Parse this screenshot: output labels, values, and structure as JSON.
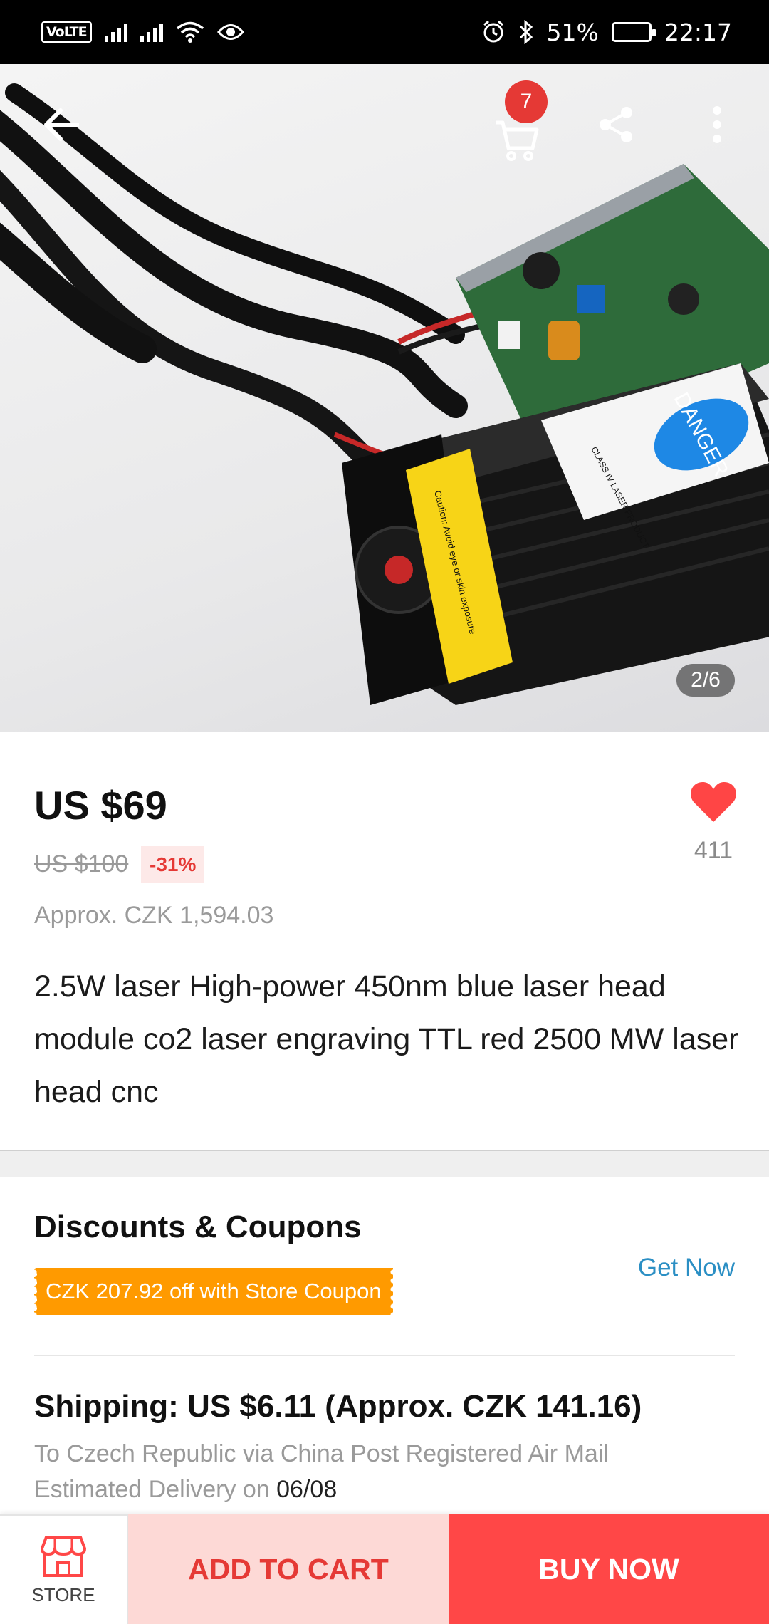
{
  "status_bar": {
    "network_badge": "VoLTE",
    "battery": "51%",
    "battery_level": 0.51,
    "time": "22:17",
    "icons": [
      "signal-icon",
      "signal-icon",
      "wifi-icon",
      "eye-icon",
      "alarm-icon",
      "bluetooth-icon",
      "battery-icon"
    ]
  },
  "header": {
    "cart_count": "7",
    "icons": [
      "back-arrow-icon",
      "cart-icon",
      "share-icon",
      "more-vertical-icon"
    ]
  },
  "gallery": {
    "pager": "2/6",
    "label_text": {
      "danger": "DANGER",
      "caution": "Caution: Avoid eye or skin exposure",
      "class": "CLASS IV LASER PRODUCT"
    }
  },
  "product": {
    "price": "US $69",
    "original_price": "US $100",
    "discount": "-31%",
    "approx_price": "Approx. CZK 1,594.03",
    "wishlist_count": "411",
    "title": "2.5W laser High-power 450nm blue laser head module co2 laser engraving TTL  red 2500 MW laser head cnc"
  },
  "coupons": {
    "heading": "Discounts & Coupons",
    "coupon_text": "CZK 207.92 off with Store Coupon",
    "action": "Get Now"
  },
  "shipping": {
    "heading": "Shipping: US $6.11 (Approx. CZK 141.16)",
    "route": "To Czech Republic via China Post Registered Air Mail",
    "delivery_prefix": "Estimated Delivery on ",
    "delivery_date": "06/08"
  },
  "bottom_bar": {
    "store_label": "STORE",
    "add_to_cart": "ADD TO CART",
    "buy_now": "BUY NOW"
  },
  "colors": {
    "accent_red": "#ff4747",
    "coupon_orange": "#ff9a00",
    "link_blue": "#2b8fc4",
    "heart": "#ff4545"
  }
}
